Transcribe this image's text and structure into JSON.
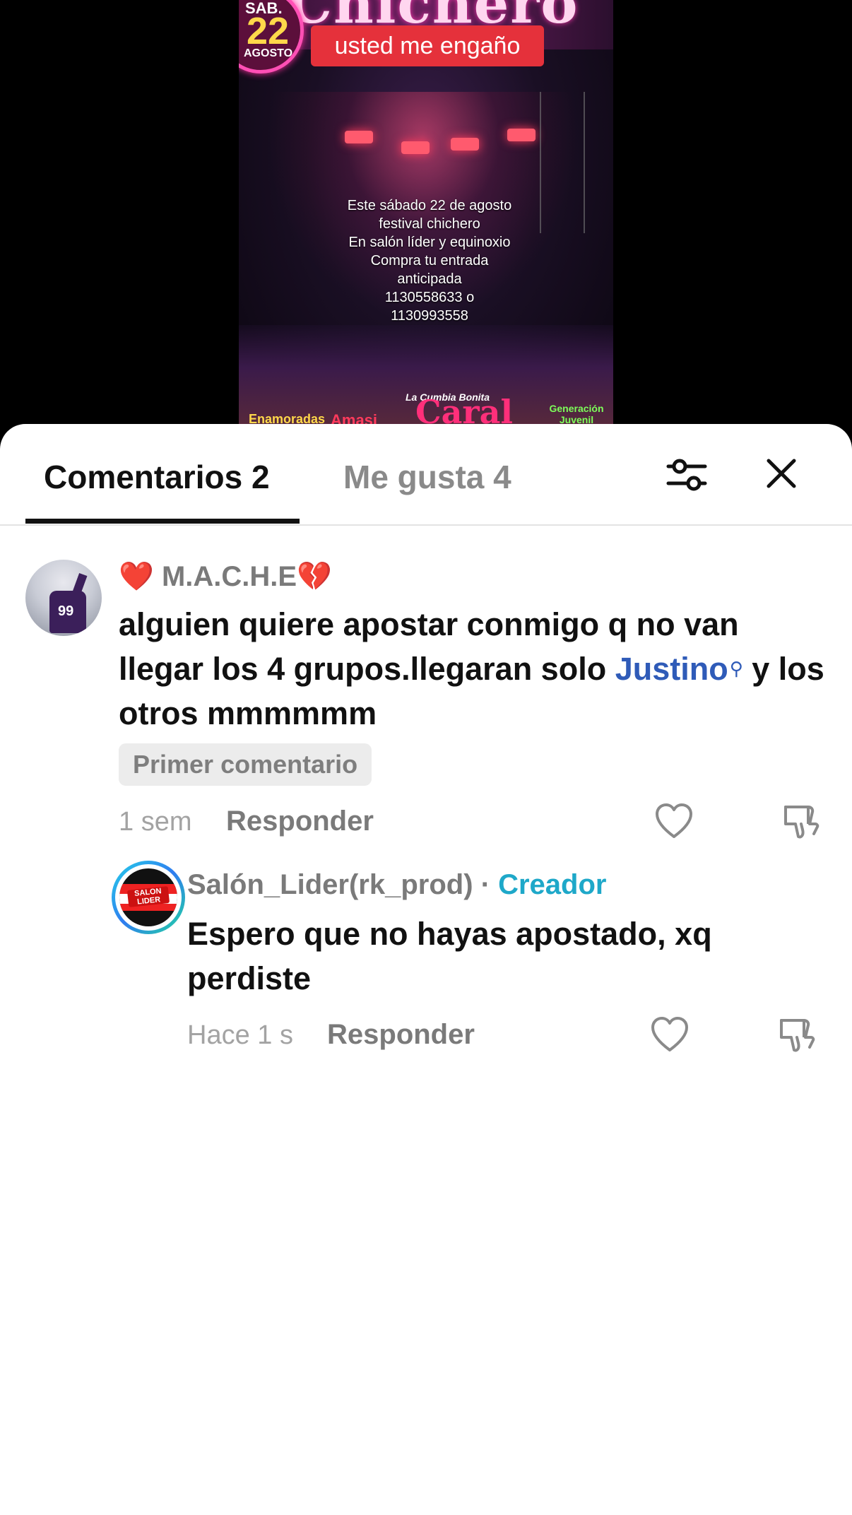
{
  "video": {
    "date_badge": {
      "line1": "SAB.",
      "day": "22",
      "line3": "AGOSTO"
    },
    "title_art": "Chichero",
    "banner": "usted me engaño",
    "poster_lines": [
      "Este sábado 22 de agosto",
      "festival chichero",
      "En salón líder y equinoxio",
      "Compra tu entrada",
      "anticipada",
      "1130558633 o",
      "1130993558"
    ],
    "band_logos": [
      "Enamoradas",
      "Amasi",
      "Caral",
      "Generación Juvenil"
    ],
    "band_tagline": "La Cumbia Bonita"
  },
  "tabs": {
    "comments_label": "Comentarios 2",
    "likes_label": "Me gusta 4"
  },
  "icons": {
    "filter": "sliders-icon",
    "close": "close-icon",
    "like": "heart-outline-icon",
    "dislike": "thumbs-down-icon"
  },
  "colors": {
    "mention": "#2f5bb8",
    "creator_badge": "#1ea8c9",
    "text_primary": "#111111",
    "text_secondary": "#7a7a7a"
  },
  "comments": [
    {
      "user_prefix_emoji": "❤️",
      "user": "M.A.C.H.E",
      "user_suffix_emoji": "💔",
      "text_before": "alguien quiere apostar conmigo q no van llegar los 4 grupos.llegaran solo ",
      "mention": "Justino",
      "text_after": " y los otros mmmmmm",
      "badge": "Primer comentario",
      "time": "1 sem",
      "reply_label": "Responder"
    }
  ],
  "replies": [
    {
      "user": "Salón_Lider(rk_prod)",
      "separator": " · ",
      "role": "Creador",
      "avatar_text": "SALON LIDER",
      "text": "Espero que no hayas apostado, xq perdiste",
      "time": "Hace 1 s",
      "reply_label": "Responder"
    }
  ]
}
